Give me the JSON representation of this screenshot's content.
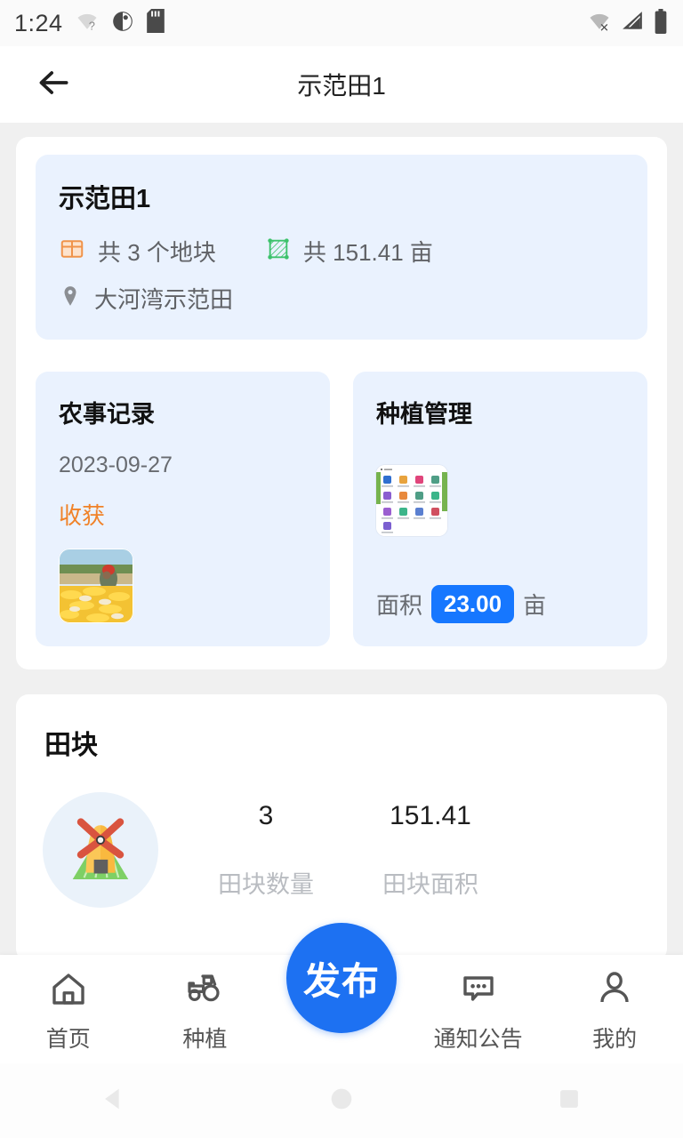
{
  "statusbar": {
    "time": "1:24",
    "left_icons": [
      "wifi-question-icon",
      "contrast-icon",
      "sdcard-icon"
    ],
    "right_icons": [
      "wifi-off-icon",
      "cellular-signal-icon",
      "battery-full-icon"
    ]
  },
  "header": {
    "back_icon": "arrow-left-icon",
    "title": "示范田1"
  },
  "summary": {
    "name": "示范田1",
    "plot_icon": "field-plot-icon",
    "plot_text": "共 3 个地块",
    "area_icon": "area-polygon-icon",
    "area_text": "共 151.41  亩",
    "location_icon": "location-pin-icon",
    "location_text": "大河湾示范田"
  },
  "tiles": [
    {
      "title": "农事记录",
      "date": "2023-09-27",
      "tag": "收获",
      "thumb": "corn-harvest-photo"
    },
    {
      "title": "种植管理",
      "thumb": "app-grid-screenshot",
      "area_label": "面积",
      "area_value": "23.00",
      "area_unit": "亩"
    }
  ],
  "field_block": {
    "title": "田块",
    "icon": "windmill-icon",
    "stats": [
      {
        "value": "3",
        "label": "田块数量"
      },
      {
        "value": "151.41",
        "label": "田块面积"
      }
    ]
  },
  "tabbar": {
    "items": [
      {
        "icon": "home-icon",
        "label": "首页"
      },
      {
        "icon": "tractor-icon",
        "label": "种植"
      },
      {
        "icon": "publish-fab",
        "label": "发布"
      },
      {
        "icon": "message-icon",
        "label": "通知公告"
      },
      {
        "icon": "person-icon",
        "label": "我的"
      }
    ]
  },
  "androidnav": {
    "back": "nav-back-triangle",
    "home": "nav-home-circle",
    "recents": "nav-recents-square"
  },
  "colors": {
    "accent": "#1677ff",
    "fab": "#1d71f2",
    "panel": "#eaf2fe",
    "page_bg": "#f0f0f0",
    "tag_orange": "#f08228",
    "muted": "#686b70"
  }
}
